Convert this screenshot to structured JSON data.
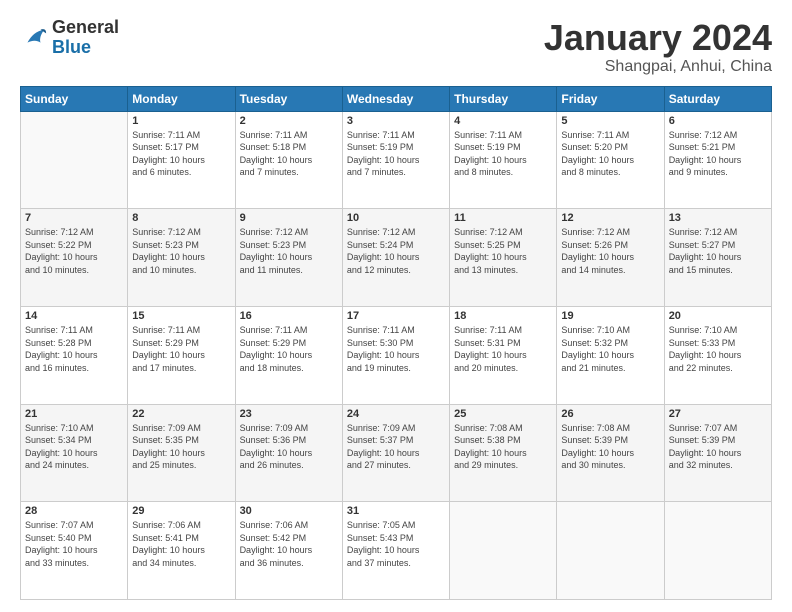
{
  "logo": {
    "general": "General",
    "blue": "Blue"
  },
  "title": {
    "month": "January 2024",
    "location": "Shangpai, Anhui, China"
  },
  "weekdays": [
    "Sunday",
    "Monday",
    "Tuesday",
    "Wednesday",
    "Thursday",
    "Friday",
    "Saturday"
  ],
  "weeks": [
    [
      {
        "day": "",
        "info": ""
      },
      {
        "day": "1",
        "info": "Sunrise: 7:11 AM\nSunset: 5:17 PM\nDaylight: 10 hours\nand 6 minutes."
      },
      {
        "day": "2",
        "info": "Sunrise: 7:11 AM\nSunset: 5:18 PM\nDaylight: 10 hours\nand 7 minutes."
      },
      {
        "day": "3",
        "info": "Sunrise: 7:11 AM\nSunset: 5:19 PM\nDaylight: 10 hours\nand 7 minutes."
      },
      {
        "day": "4",
        "info": "Sunrise: 7:11 AM\nSunset: 5:19 PM\nDaylight: 10 hours\nand 8 minutes."
      },
      {
        "day": "5",
        "info": "Sunrise: 7:11 AM\nSunset: 5:20 PM\nDaylight: 10 hours\nand 8 minutes."
      },
      {
        "day": "6",
        "info": "Sunrise: 7:12 AM\nSunset: 5:21 PM\nDaylight: 10 hours\nand 9 minutes."
      }
    ],
    [
      {
        "day": "7",
        "info": "Sunrise: 7:12 AM\nSunset: 5:22 PM\nDaylight: 10 hours\nand 10 minutes."
      },
      {
        "day": "8",
        "info": "Sunrise: 7:12 AM\nSunset: 5:23 PM\nDaylight: 10 hours\nand 10 minutes."
      },
      {
        "day": "9",
        "info": "Sunrise: 7:12 AM\nSunset: 5:23 PM\nDaylight: 10 hours\nand 11 minutes."
      },
      {
        "day": "10",
        "info": "Sunrise: 7:12 AM\nSunset: 5:24 PM\nDaylight: 10 hours\nand 12 minutes."
      },
      {
        "day": "11",
        "info": "Sunrise: 7:12 AM\nSunset: 5:25 PM\nDaylight: 10 hours\nand 13 minutes."
      },
      {
        "day": "12",
        "info": "Sunrise: 7:12 AM\nSunset: 5:26 PM\nDaylight: 10 hours\nand 14 minutes."
      },
      {
        "day": "13",
        "info": "Sunrise: 7:12 AM\nSunset: 5:27 PM\nDaylight: 10 hours\nand 15 minutes."
      }
    ],
    [
      {
        "day": "14",
        "info": "Sunrise: 7:11 AM\nSunset: 5:28 PM\nDaylight: 10 hours\nand 16 minutes."
      },
      {
        "day": "15",
        "info": "Sunrise: 7:11 AM\nSunset: 5:29 PM\nDaylight: 10 hours\nand 17 minutes."
      },
      {
        "day": "16",
        "info": "Sunrise: 7:11 AM\nSunset: 5:29 PM\nDaylight: 10 hours\nand 18 minutes."
      },
      {
        "day": "17",
        "info": "Sunrise: 7:11 AM\nSunset: 5:30 PM\nDaylight: 10 hours\nand 19 minutes."
      },
      {
        "day": "18",
        "info": "Sunrise: 7:11 AM\nSunset: 5:31 PM\nDaylight: 10 hours\nand 20 minutes."
      },
      {
        "day": "19",
        "info": "Sunrise: 7:10 AM\nSunset: 5:32 PM\nDaylight: 10 hours\nand 21 minutes."
      },
      {
        "day": "20",
        "info": "Sunrise: 7:10 AM\nSunset: 5:33 PM\nDaylight: 10 hours\nand 22 minutes."
      }
    ],
    [
      {
        "day": "21",
        "info": "Sunrise: 7:10 AM\nSunset: 5:34 PM\nDaylight: 10 hours\nand 24 minutes."
      },
      {
        "day": "22",
        "info": "Sunrise: 7:09 AM\nSunset: 5:35 PM\nDaylight: 10 hours\nand 25 minutes."
      },
      {
        "day": "23",
        "info": "Sunrise: 7:09 AM\nSunset: 5:36 PM\nDaylight: 10 hours\nand 26 minutes."
      },
      {
        "day": "24",
        "info": "Sunrise: 7:09 AM\nSunset: 5:37 PM\nDaylight: 10 hours\nand 27 minutes."
      },
      {
        "day": "25",
        "info": "Sunrise: 7:08 AM\nSunset: 5:38 PM\nDaylight: 10 hours\nand 29 minutes."
      },
      {
        "day": "26",
        "info": "Sunrise: 7:08 AM\nSunset: 5:39 PM\nDaylight: 10 hours\nand 30 minutes."
      },
      {
        "day": "27",
        "info": "Sunrise: 7:07 AM\nSunset: 5:39 PM\nDaylight: 10 hours\nand 32 minutes."
      }
    ],
    [
      {
        "day": "28",
        "info": "Sunrise: 7:07 AM\nSunset: 5:40 PM\nDaylight: 10 hours\nand 33 minutes."
      },
      {
        "day": "29",
        "info": "Sunrise: 7:06 AM\nSunset: 5:41 PM\nDaylight: 10 hours\nand 34 minutes."
      },
      {
        "day": "30",
        "info": "Sunrise: 7:06 AM\nSunset: 5:42 PM\nDaylight: 10 hours\nand 36 minutes."
      },
      {
        "day": "31",
        "info": "Sunrise: 7:05 AM\nSunset: 5:43 PM\nDaylight: 10 hours\nand 37 minutes."
      },
      {
        "day": "",
        "info": ""
      },
      {
        "day": "",
        "info": ""
      },
      {
        "day": "",
        "info": ""
      }
    ]
  ]
}
